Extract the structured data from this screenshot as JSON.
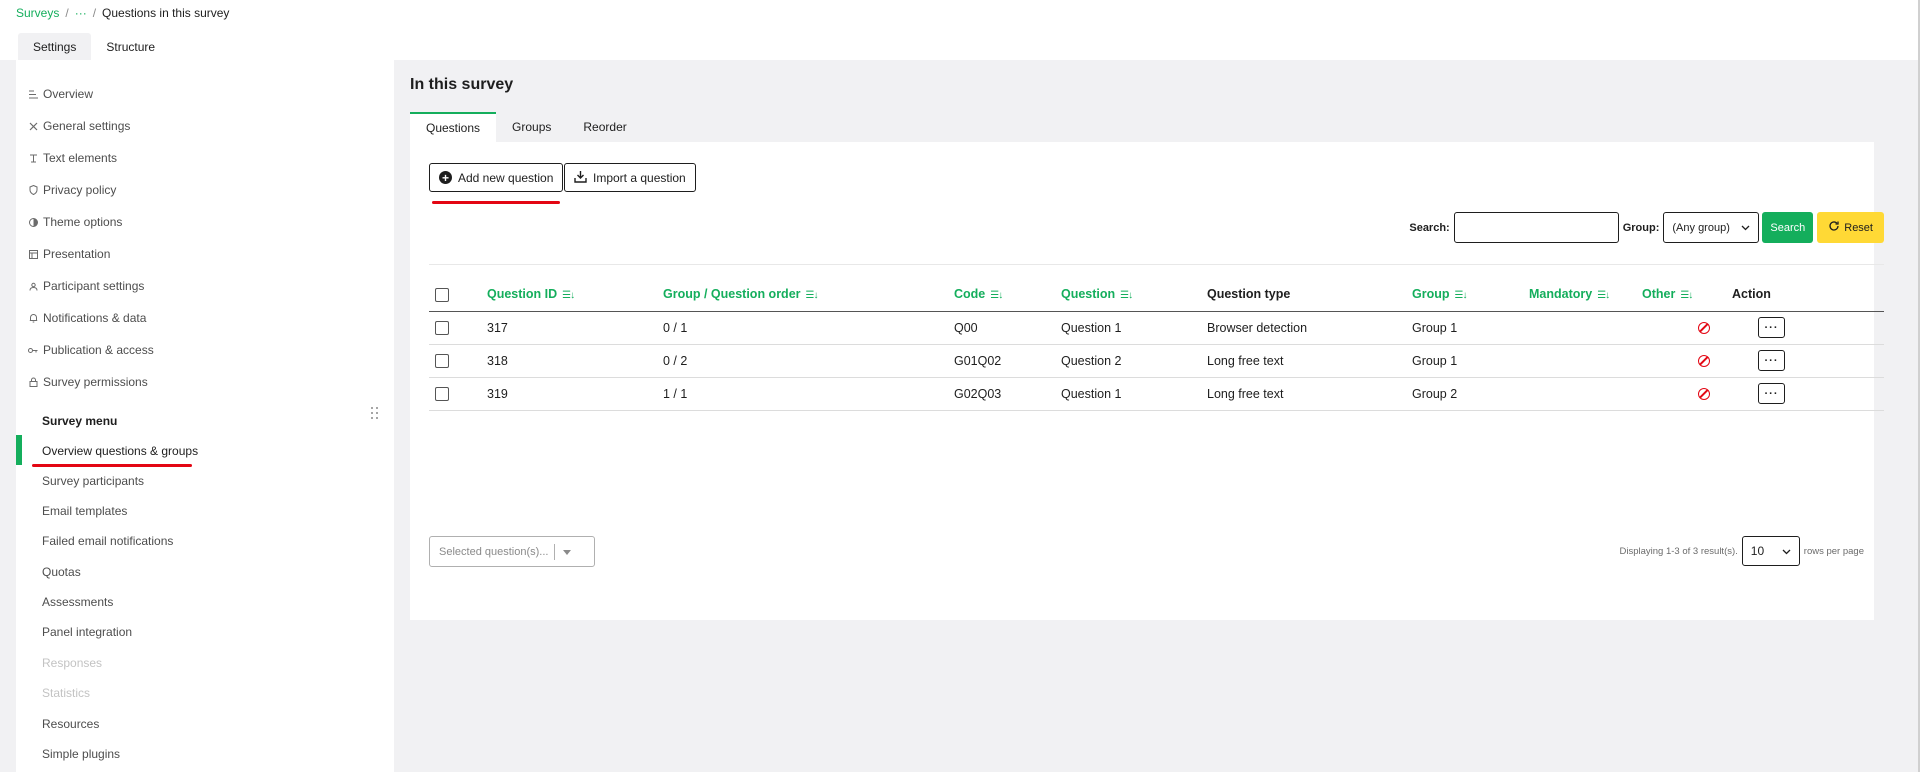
{
  "breadcrumb": {
    "root": "Surveys",
    "middle": "···",
    "current": "Questions in this survey",
    "sep": "/"
  },
  "top_tabs": [
    {
      "label": "Settings",
      "active": true
    },
    {
      "label": "Structure",
      "active": false
    }
  ],
  "sidebar": {
    "settings_items": [
      {
        "label": "Overview",
        "icon": "list-icon"
      },
      {
        "label": "General settings",
        "icon": "tools-icon"
      },
      {
        "label": "Text elements",
        "icon": "text-icon"
      },
      {
        "label": "Privacy policy",
        "icon": "shield-icon"
      },
      {
        "label": "Theme options",
        "icon": "contrast-icon"
      },
      {
        "label": "Presentation",
        "icon": "layout-icon"
      },
      {
        "label": "Participant settings",
        "icon": "participants-icon"
      },
      {
        "label": "Notifications & data",
        "icon": "bell-icon"
      },
      {
        "label": "Publication & access",
        "icon": "key-icon"
      },
      {
        "label": "Survey permissions",
        "icon": "lock-icon"
      }
    ],
    "menu_title": "Survey menu",
    "menu_items": [
      {
        "label": "Overview questions & groups",
        "state": "active"
      },
      {
        "label": "Survey participants",
        "state": "normal"
      },
      {
        "label": "Email templates",
        "state": "normal"
      },
      {
        "label": "Failed email notifications",
        "state": "normal"
      },
      {
        "label": "Quotas",
        "state": "normal"
      },
      {
        "label": "Assessments",
        "state": "normal"
      },
      {
        "label": "Panel integration",
        "state": "normal"
      },
      {
        "label": "Responses",
        "state": "disabled"
      },
      {
        "label": "Statistics",
        "state": "disabled"
      },
      {
        "label": "Resources",
        "state": "normal"
      },
      {
        "label": "Simple plugins",
        "state": "normal"
      }
    ]
  },
  "main": {
    "title": "In this survey",
    "tabs": [
      {
        "label": "Questions",
        "active": true
      },
      {
        "label": "Groups",
        "active": false
      },
      {
        "label": "Reorder",
        "active": false
      }
    ],
    "add_button": "Add new question",
    "import_button": "Import a question",
    "search_label": "Search:",
    "search_value": "",
    "group_label": "Group:",
    "group_value": "(Any group)",
    "search_button": "Search",
    "reset_button": "Reset",
    "columns": [
      {
        "label": "Question ID",
        "sortable": true
      },
      {
        "label": "Group / Question order",
        "sortable": true
      },
      {
        "label": "Code",
        "sortable": true
      },
      {
        "label": "Question",
        "sortable": true
      },
      {
        "label": "Question type",
        "sortable": false
      },
      {
        "label": "Group",
        "sortable": true
      },
      {
        "label": "Mandatory",
        "sortable": true
      },
      {
        "label": "Other",
        "sortable": true
      },
      {
        "label": "Action",
        "sortable": false
      }
    ],
    "rows": [
      {
        "id": "317",
        "order": "0 / 1",
        "code": "Q00",
        "question": "Question 1",
        "type": "Browser detection",
        "group": "Group 1",
        "mandatory": "",
        "other": "no"
      },
      {
        "id": "318",
        "order": "0 / 2",
        "code": "G01Q02",
        "question": "Question 2",
        "type": "Long free text",
        "group": "Group 1",
        "mandatory": "",
        "other": "no"
      },
      {
        "id": "319",
        "order": "1 / 1",
        "code": "G02Q03",
        "question": "Question 1",
        "type": "Long free text",
        "group": "Group 2",
        "mandatory": "",
        "other": "no"
      }
    ],
    "selected_placeholder": "Selected question(s)...",
    "displaying": "Displaying 1-3 of 3 result(s).",
    "rows_per_page": "10",
    "rows_per_page_label": "rows per page"
  },
  "colors": {
    "accent": "#14ae5c",
    "warning": "#ffd935",
    "highlight": "#e30613"
  }
}
